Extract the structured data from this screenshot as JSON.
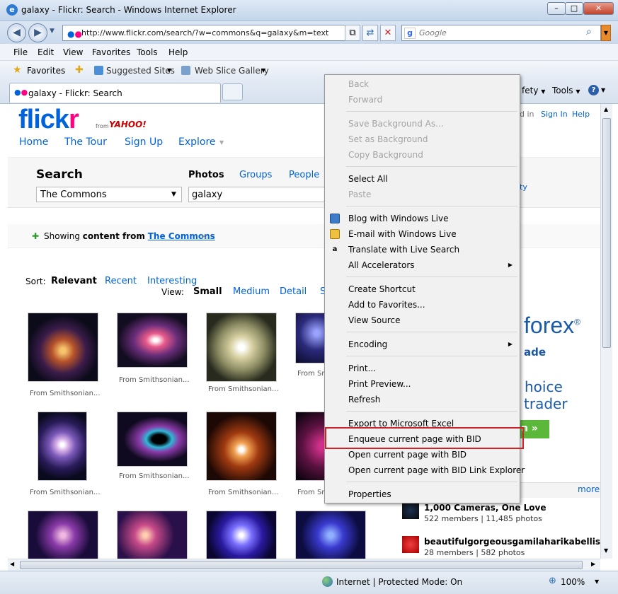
{
  "window": {
    "title": "galaxy - Flickr: Search - Windows Internet Explorer",
    "address": "http://www.flickr.com/search/?w=commons&q=galaxy&m=text",
    "search_placeholder": "Google"
  },
  "menu": [
    "File",
    "Edit",
    "View",
    "Favorites",
    "Tools",
    "Help"
  ],
  "favorites_bar": {
    "favorites": "Favorites",
    "suggested": "Suggested Sites",
    "webslice": "Web Slice Gallery"
  },
  "tab": {
    "label": "galaxy - Flickr: Search"
  },
  "command_bar": {
    "safety": "fety",
    "tools": "Tools"
  },
  "flickr": {
    "logo": "flickr",
    "from": "from",
    "yahoo": "YAHOO!",
    "nav": [
      "Home",
      "The Tour",
      "Sign Up",
      "Explore"
    ],
    "top_links": {
      "signed": "d in",
      "signin": "Sign In",
      "help": "Help"
    },
    "search_heading": "Search",
    "search_tabs": [
      "Photos",
      "Groups",
      "People"
    ],
    "scope": "The Commons",
    "query": "galaxy",
    "right_link": "ty",
    "showing_prefix": "Showing",
    "showing_mid": "content from",
    "showing_link": "The Commons",
    "close_x": "×",
    "sort_label": "Sort:",
    "sort_options": [
      "Relevant",
      "Recent",
      "Interesting"
    ],
    "view_label": "View:",
    "view_options": [
      "Small",
      "Medium",
      "Detail",
      "S"
    ],
    "captions": [
      "From Smithsonian...",
      "From Smithsonian...",
      "From Smithsonian...",
      "From Sm"
    ],
    "ad": {
      "brand": "forex",
      "reg": "®",
      "line1": "ade",
      "line2": "hoice",
      "line3": "trader",
      "btn": "n »"
    },
    "more": "more.",
    "groups": [
      {
        "name": "1,000 Cameras, One Love",
        "meta": "522 members | 11,485 photos"
      },
      {
        "name": "beautifulgorgeousgamilaharikabellissima",
        "meta": "28 members | 582 photos"
      }
    ]
  },
  "context_menu": {
    "items": [
      {
        "label": "Back",
        "disabled": true
      },
      {
        "label": "Forward",
        "disabled": true
      },
      {
        "label": "Save Background As...",
        "disabled": true
      },
      {
        "label": "Set as Background",
        "disabled": true
      },
      {
        "label": "Copy Background",
        "disabled": true
      },
      {
        "label": "Select All",
        "disabled": false
      },
      {
        "label": "Paste",
        "disabled": true
      },
      {
        "label": "Blog with Windows Live",
        "disabled": false
      },
      {
        "label": "E-mail with Windows Live",
        "disabled": false
      },
      {
        "label": "Translate with Live Search",
        "disabled": false
      },
      {
        "label": "All Accelerators",
        "disabled": false
      },
      {
        "label": "Create Shortcut",
        "disabled": false
      },
      {
        "label": "Add to Favorites...",
        "disabled": false
      },
      {
        "label": "View Source",
        "disabled": false
      },
      {
        "label": "Encoding",
        "disabled": false
      },
      {
        "label": "Print...",
        "disabled": false
      },
      {
        "label": "Print Preview...",
        "disabled": false
      },
      {
        "label": "Refresh",
        "disabled": false
      },
      {
        "label": "Export to Microsoft Excel",
        "disabled": false
      },
      {
        "label": "Enqueue current page with BID",
        "disabled": false
      },
      {
        "label": "Open current page with BID",
        "disabled": false
      },
      {
        "label": "Open current page with BID Link Explorer",
        "disabled": false
      },
      {
        "label": "Properties",
        "disabled": false
      }
    ]
  },
  "status": {
    "zone": "Internet | Protected Mode: On",
    "zoom": "100%"
  },
  "colors": {
    "highlight": "#d0202a",
    "flickr_blue": "#0063dc",
    "flickr_pink": "#ff0084"
  }
}
